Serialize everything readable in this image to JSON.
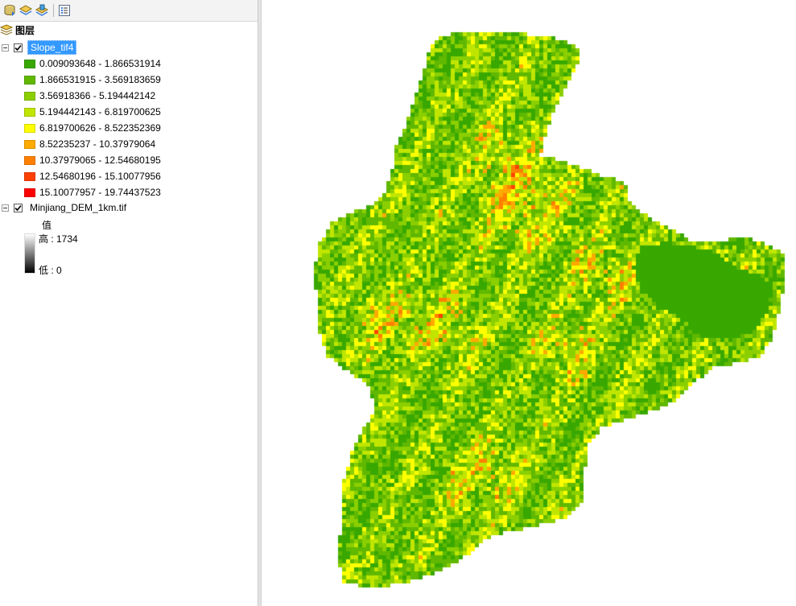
{
  "toolbar": {
    "buttons": [
      {
        "icon": "list-by-drawing-order-icon"
      },
      {
        "icon": "list-by-source-icon"
      },
      {
        "icon": "list-by-visibility-icon"
      },
      {
        "icon": "options-icon"
      }
    ]
  },
  "toc": {
    "root_label": "图层",
    "layers": [
      {
        "name": "Slope_tif4",
        "checked": true,
        "selected": true,
        "classes": [
          {
            "label": "0.009093648 - 1.866531914",
            "color": "#38a800"
          },
          {
            "label": "1.866531915 - 3.569183659",
            "color": "#60b800"
          },
          {
            "label": "3.56918366 - 5.194442142",
            "color": "#8bcf00"
          },
          {
            "label": "5.194442143 - 6.819700625",
            "color": "#c0e600"
          },
          {
            "label": "6.819700626 - 8.522352369",
            "color": "#ffff00"
          },
          {
            "label": "8.52235237 - 10.37979064",
            "color": "#ffaa00"
          },
          {
            "label": "10.37979065 - 12.54680195",
            "color": "#ff8000"
          },
          {
            "label": "12.54680196 - 15.10077956",
            "color": "#ff4000"
          },
          {
            "label": "15.10077957 - 19.74437523",
            "color": "#ff0000"
          }
        ]
      },
      {
        "name": "Minjiang_DEM_1km.tif",
        "checked": true,
        "selected": false,
        "field_label": "值",
        "high_label": "高 : 1734",
        "low_label": "低 : 0"
      }
    ]
  },
  "map": {
    "flat_area_color": "#38a800"
  }
}
